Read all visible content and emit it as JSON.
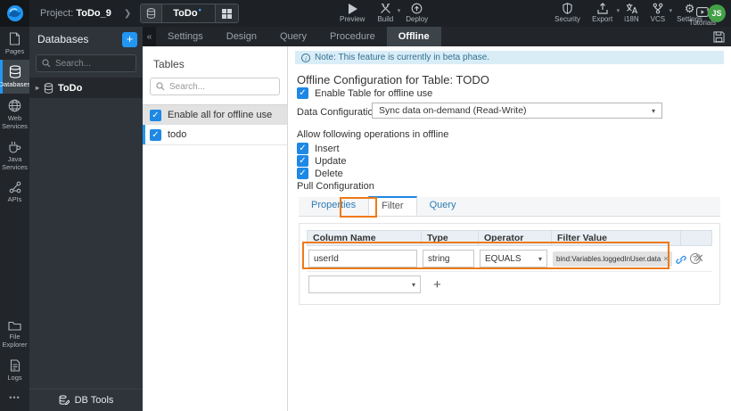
{
  "colors": {
    "accent_blue": "#1e88e5",
    "annotation_orange": "#ee7a17",
    "note_background": "#d9edf7",
    "avatar_green": "#43a047",
    "topbar_background": "#1d2125"
  },
  "topbar": {
    "project_prefix": "Project:",
    "project_name": "ToDo_9",
    "breadcrumb_chevron": "❯",
    "doc_tab": {
      "label": "ToDo",
      "modified_marker": "•"
    },
    "actions_left": [
      {
        "label": "Preview"
      },
      {
        "label": "Build"
      },
      {
        "label": "Deploy"
      }
    ],
    "tutorials_label": "Tutorials",
    "actions_right": [
      {
        "label": "Security"
      },
      {
        "label": "Export"
      },
      {
        "label": "i18N"
      },
      {
        "label": "VCS"
      },
      {
        "label": "Settings"
      }
    ],
    "avatar_initials": "JS"
  },
  "rail": {
    "top_items": [
      {
        "label": "Pages"
      },
      {
        "label": "Databases"
      },
      {
        "label": "Web Services"
      },
      {
        "label": "Java Services"
      },
      {
        "label": "APIs"
      }
    ],
    "bottom_items": [
      {
        "label": "File Explorer"
      },
      {
        "label": "Logs"
      }
    ],
    "more_label": "•••"
  },
  "databases_panel": {
    "title": "Databases",
    "add_button": "+",
    "search_placeholder": "Search...",
    "tree_expander": "▸",
    "tree": [
      {
        "label": "ToDo"
      }
    ],
    "footer_label": "DB Tools"
  },
  "workspace_tabs": {
    "collapse": "«",
    "items": [
      {
        "label": "Settings"
      },
      {
        "label": "Design"
      },
      {
        "label": "Query"
      },
      {
        "label": "Procedure"
      },
      {
        "label": "Offline"
      }
    ]
  },
  "tables_panel": {
    "title": "Tables",
    "search_placeholder": "Search...",
    "enable_all_label": "Enable all for offline use",
    "tables": [
      {
        "label": "todo"
      }
    ]
  },
  "offline": {
    "note": "Note: This feature is currently in beta phase.",
    "info_glyph": "i",
    "title": "Offline Configuration for Table: TODO",
    "enable_table_label": "Enable Table for offline use",
    "data_config_label": "Data Configuration",
    "data_config_value": "Sync data on-demand (Read-Write)",
    "select_caret": "▾",
    "operations_label": "Allow following operations in offline",
    "operations": [
      {
        "label": "Insert"
      },
      {
        "label": "Update"
      },
      {
        "label": "Delete"
      }
    ],
    "pull_config_label": "Pull Configuration",
    "pull_tabs": [
      {
        "label": "Properties"
      },
      {
        "label": "Filter"
      },
      {
        "label": "Query"
      }
    ],
    "filter_table": {
      "headers": [
        "Column Name",
        "Type",
        "Operator",
        "Filter Value"
      ],
      "row": {
        "column_name": "userId",
        "type": "string",
        "operator": "EQUALS",
        "filter_value": "bind:Variables.loggedInUser.data",
        "chip_remove": "×",
        "help_glyph": "?",
        "row_remove": "✕"
      },
      "add_label": "+"
    }
  }
}
